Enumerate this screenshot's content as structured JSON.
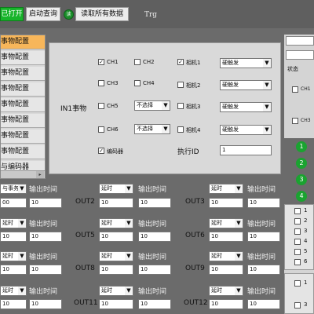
{
  "toolbar": {
    "open_button": "已打开",
    "start_query_button": "启动查询",
    "read_icon_text": "读",
    "read_all_label": "读取所有数据",
    "trg_label": "Trg"
  },
  "sidebar": {
    "items": [
      "事物配置",
      "事物配置",
      "事物配置",
      "事物配置",
      "事物配置",
      "事物配置",
      "事物配置",
      "事物配置",
      "与编码器"
    ],
    "scroll_arrow": "▸"
  },
  "panel": {
    "in1_label": "IN1事物",
    "ch1": "CH1",
    "ch2": "CH2",
    "ch3": "CH3",
    "ch4": "CH4",
    "ch5": "CH5",
    "ch6": "CH6",
    "ch1_check": "✓",
    "cam1": "相机1",
    "cam2": "相机2",
    "cam3": "相机3",
    "cam4": "相机4",
    "cam1_check": "✓",
    "hard_trigger": "硬触发",
    "not_selected": "不选择",
    "encoder": "编码器",
    "encoder_check": "✓",
    "exec_id_label": "执行ID",
    "exec_id_value": "1",
    "dropdown_arrow": "▼"
  },
  "right_panel": {
    "status": "状态",
    "ch1": "CH1",
    "ch3": "CH3",
    "circles": [
      "1",
      "2",
      "3",
      "4"
    ],
    "list": [
      "1",
      "2",
      "3",
      "4",
      "5",
      "6"
    ],
    "list2": [
      "1",
      "3"
    ]
  },
  "grid": {
    "output_time": "输出时间",
    "delay": "延时",
    "value_10": "10",
    "value_00": "00",
    "row1_left": "与事务",
    "out_labels": [
      "OUT2",
      "OUT3",
      "OUT5",
      "OUT6",
      "OUT8",
      "OUT9",
      "OUT11",
      "OUT12"
    ]
  }
}
